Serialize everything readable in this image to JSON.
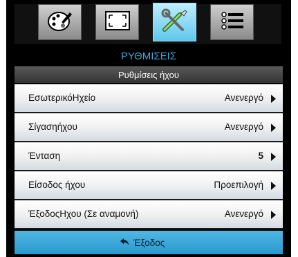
{
  "tabs": [
    {
      "icon": "palette-icon",
      "active": false
    },
    {
      "icon": "screen-resize-icon",
      "active": false
    },
    {
      "icon": "settings-tools-icon",
      "active": true
    },
    {
      "icon": "options-list-icon",
      "active": false
    }
  ],
  "header": {
    "title": "ΡΥΘΜΙΣΕΙΣ"
  },
  "subheader": {
    "title": "Ρυθμίσεις ήχου"
  },
  "rows": [
    {
      "label": "ΕσωτερικόΗχείο",
      "value": "Ανενεργό"
    },
    {
      "label": "Σίγασηήχου",
      "value": "Ανενεργό"
    },
    {
      "label": "Ένταση",
      "value": "5"
    },
    {
      "label": "Είσοδος ήχου",
      "value": "Προεπιλογή"
    },
    {
      "label": "ΈξοδοςΗχου (Σε αναμονή)",
      "value": "Ανενεργό"
    }
  ],
  "footer": {
    "exit_label": "Έξοδος"
  },
  "colors": {
    "accent": "#3aa9dc",
    "active_tab": "#5fc6ec",
    "footer": "#2a98cf"
  }
}
